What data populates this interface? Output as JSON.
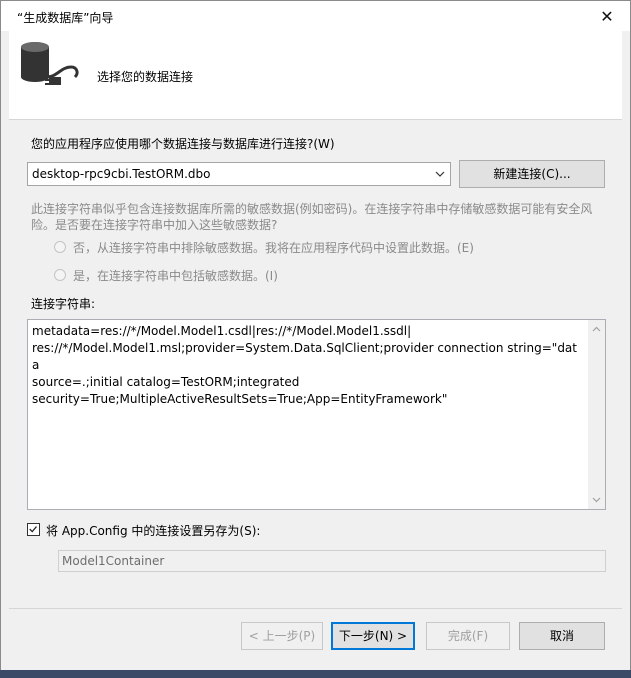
{
  "window": {
    "title": "“生成数据库”向导",
    "close_glyph": "✕"
  },
  "banner": {
    "title": "选择您的数据连接",
    "icon": "database-plug-icon"
  },
  "connection": {
    "question": "您的应用程序应使用哪个数据连接与数据库进行连接?(W)",
    "selected": "desktop-rpc9cbi.TestORM.dbo",
    "new_button": "新建连接(C)..."
  },
  "sensitive": {
    "warning_line1": "此连接字符串似乎包含连接数据库所需的敏感数据(例如密码)。在连接字符串中存储敏感数据可能有安全风",
    "warning_line2": "险。是否要在连接字符串中加入这些敏感数据?",
    "option_exclude": "否，从连接字符串中排除敏感数据。我将在应用程序代码中设置此数据。(E)",
    "option_include": "是，在连接字符串中包括敏感数据。(I)"
  },
  "connection_string": {
    "label": "连接字符串:",
    "value": "metadata=res://*/Model.Model1.csdl|res://*/Model.Model1.ssdl|\nres://*/Model.Model1.msl;provider=System.Data.SqlClient;provider connection string=\"data\nsource=.;initial catalog=TestORM;integrated\nsecurity=True;MultipleActiveResultSets=True;App=EntityFramework\""
  },
  "save": {
    "checked": true,
    "label": "将 App.Config 中的连接设置另存为(S):",
    "container_name": "Model1Container"
  },
  "buttons": {
    "prev": "< 上一步(P)",
    "next": "下一步(N) >",
    "finish": "完成(F)",
    "cancel": "取消"
  },
  "colors": {
    "accent": "#0078d7",
    "disabled_text": "#a0a0a0"
  }
}
